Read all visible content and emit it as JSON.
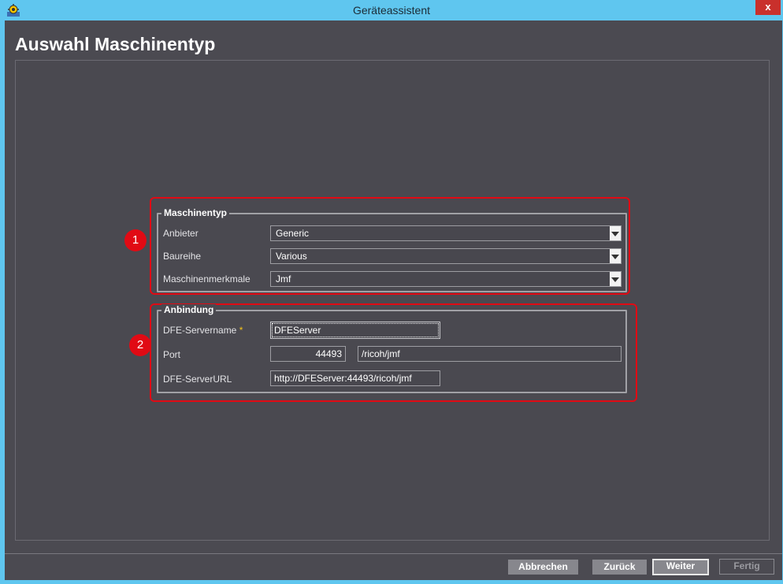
{
  "window": {
    "title": "Geräteassistent",
    "close_label": "x"
  },
  "page": {
    "title": "Auswahl Maschinentyp"
  },
  "machine_group": {
    "title": "Maschinentyp",
    "vendor_label": "Anbieter",
    "vendor_value": "Generic",
    "series_label": "Baureihe",
    "series_value": "Various",
    "features_label": "Maschinenmerkmale",
    "features_value": "Jmf"
  },
  "connection_group": {
    "title": "Anbindung",
    "servername_label": "DFE-Servername",
    "required_marker": "*",
    "servername_value": "DFEServer",
    "port_label": "Port",
    "port_value": "44493",
    "path_value": "/ricoh/jmf",
    "url_label": "DFE-ServerURL",
    "url_value": "http://DFEServer:44493/ricoh/jmf"
  },
  "callouts": {
    "one": "1",
    "two": "2"
  },
  "footer": {
    "cancel": "Abbrechen",
    "back": "Zurück",
    "next": "Weiter",
    "finish": "Fertig"
  },
  "colors": {
    "callout": "#e10a14",
    "background": "#4b4a51",
    "titlebar": "#5fc6ef"
  }
}
